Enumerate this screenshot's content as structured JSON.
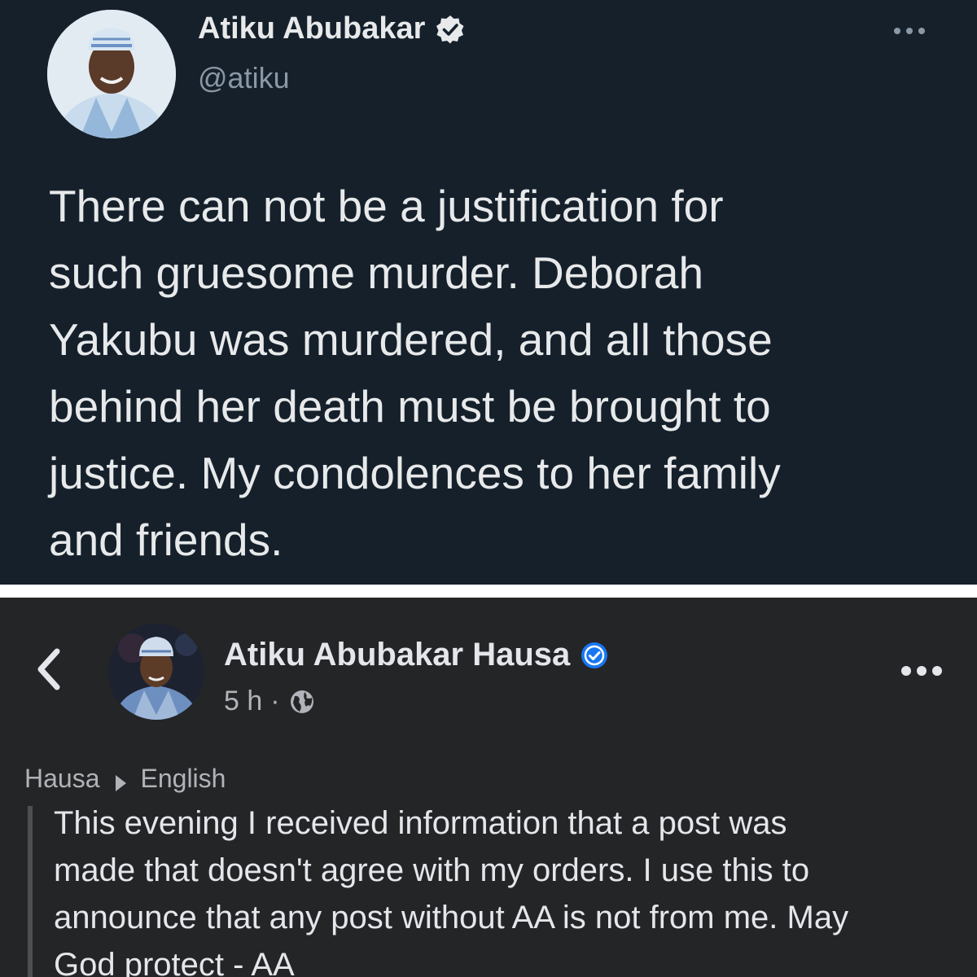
{
  "twitter_post": {
    "author_name": "Atiku Abubakar",
    "handle": "@atiku",
    "text": "There can not be a justification for\nsuch gruesome murder. Deborah\nYakubu was murdered, and all those\nbehind her death must be brought to\njustice. My condolences to her family\nand friends.",
    "icons": {
      "verified": "verified-badge-icon",
      "more": "more-options-icon"
    }
  },
  "facebook_post": {
    "author_name": "Atiku Abubakar Hausa",
    "time": "5 h",
    "separator": "·",
    "translation": {
      "from": "Hausa",
      "to": "English"
    },
    "text": "This evening I received information that a post was\nmade that doesn't agree with my orders. I use this to\nannounce that any post without AA is not from me. May\nGod protect - AA",
    "icons": {
      "back": "back-chevron-icon",
      "verified": "verified-badge-icon",
      "audience": "globe-icon",
      "more": "more-options-icon",
      "translate_arrow": "arrow-right-icon"
    }
  },
  "colors": {
    "twitter_bg": "#15202b",
    "facebook_bg": "#242526",
    "verified_blue": "#1877f2",
    "text_primary": "#e7e9ea",
    "text_secondary": "#8b98a5"
  }
}
